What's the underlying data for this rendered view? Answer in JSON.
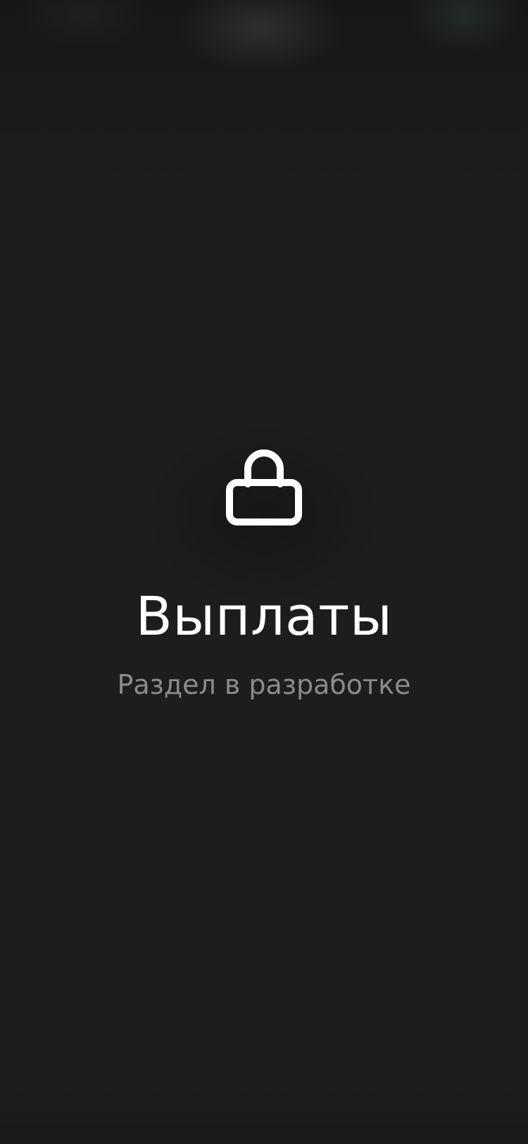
{
  "screen": {
    "icon": "lock-icon",
    "title": "Выплаты",
    "subtitle": "Раздел в разработке"
  },
  "colors": {
    "background": "#1c1d1f",
    "title": "#ffffff",
    "subtitle": "#8a8b8d",
    "icon": "#ffffff"
  }
}
